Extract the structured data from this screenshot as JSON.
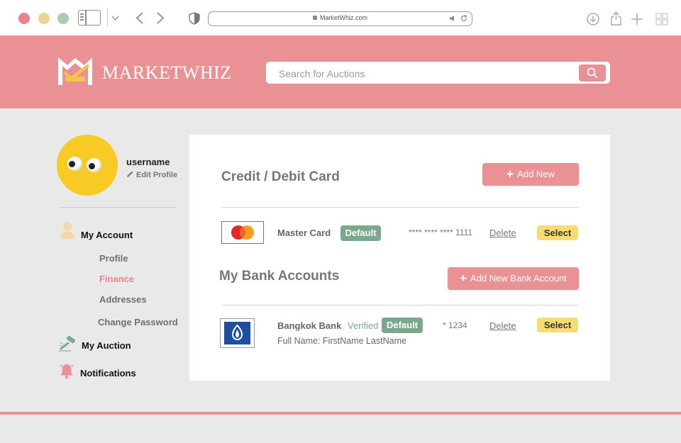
{
  "browser": {
    "url": "MarketWhiz.com"
  },
  "header": {
    "brand": "MARKETWHIZ",
    "search_placeholder": "Search for Auctions"
  },
  "profile": {
    "username": "username",
    "edit_label": "Edit Profile"
  },
  "nav": {
    "my_account": "My Account",
    "sub_items": [
      "Profile",
      "Finance",
      "Addresses",
      "Change Password"
    ],
    "active_item": "Finance",
    "my_auction": "My Auction",
    "notifications": "Notifications"
  },
  "cards": {
    "title": "Credit / Debit Card",
    "add_label": "Add New",
    "items": [
      {
        "name": "Master Card",
        "badge": "Default",
        "number": "**** **** **** 1111",
        "delete_label": "Delete",
        "select_label": "Select"
      }
    ]
  },
  "banks": {
    "title": "My Bank Accounts",
    "add_label": "Add New Bank Account",
    "items": [
      {
        "name": "Bangkok Bank",
        "status": "Verified",
        "badge": "Default",
        "number": "* 1234",
        "full_name": "Full Name: FirstName LastName",
        "delete_label": "Delete",
        "select_label": "Select"
      }
    ]
  },
  "colors": {
    "accent": "#e99195",
    "success": "#7aa88c",
    "select": "#f7dc6f",
    "avatar": "#f7cb24"
  }
}
